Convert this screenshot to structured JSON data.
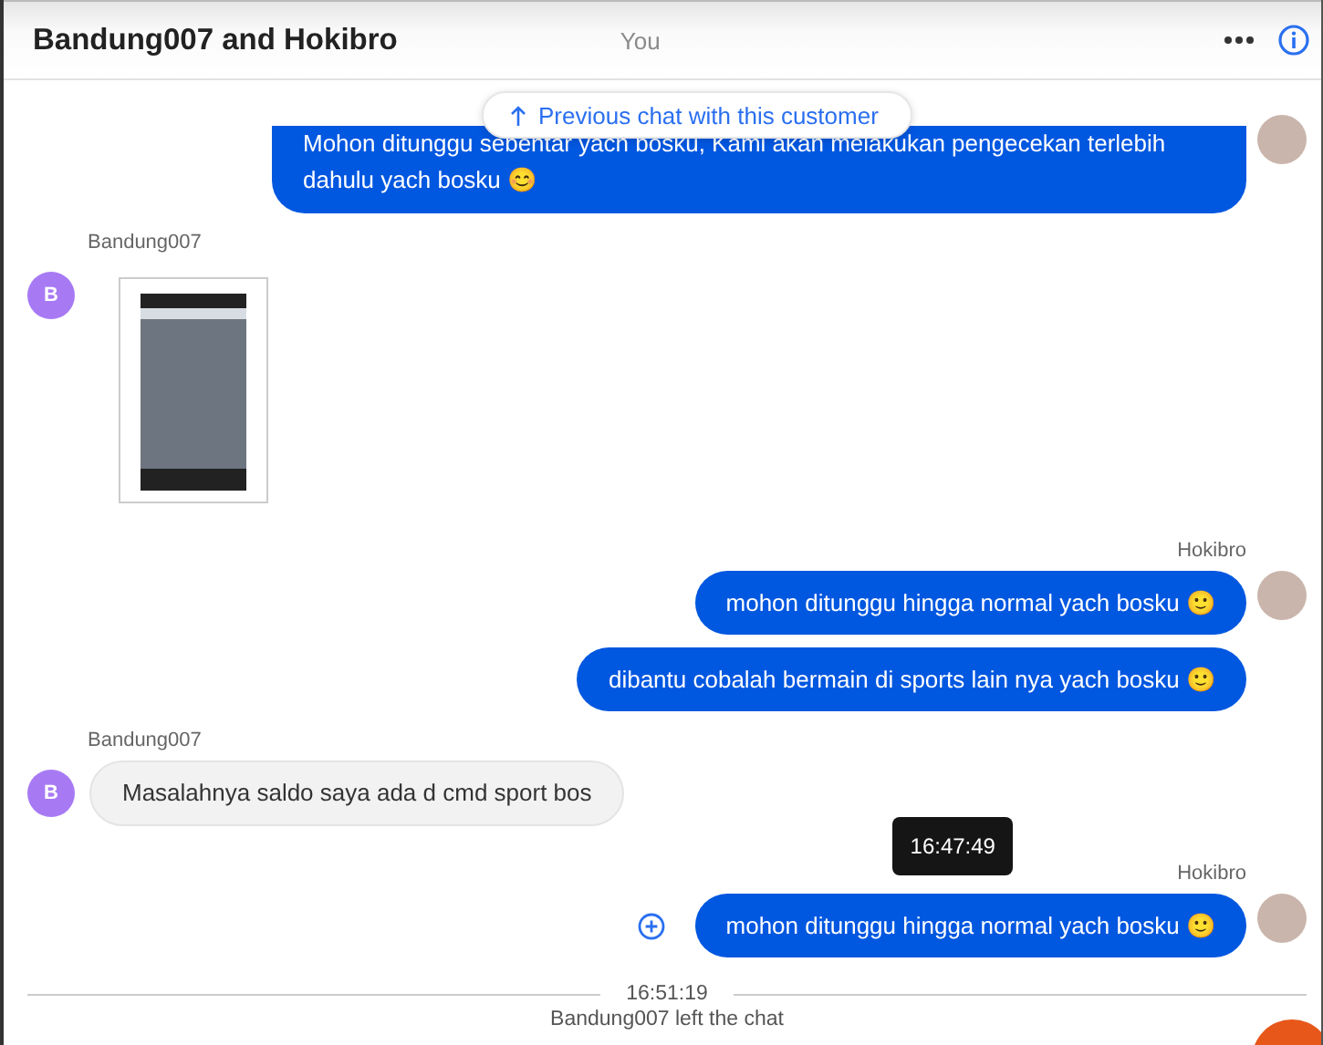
{
  "header": {
    "title": "Bandung007 and Hokibro",
    "you_label": "You"
  },
  "previous_chat_button": {
    "label": "Previous chat with this customer"
  },
  "groups": [
    {
      "kind": "agent",
      "messages": [
        {
          "kind": "text",
          "text": "Mohon ditunggu sebentar yach bosku, Kami akan melakukan pengecekan terlebih dahulu yach bosku 😊"
        }
      ]
    },
    {
      "kind": "customer",
      "sender": "Bandung007",
      "avatar_letter": "B",
      "messages": [
        {
          "kind": "image"
        }
      ]
    },
    {
      "kind": "agent",
      "sender": "Hokibro",
      "messages": [
        {
          "kind": "text",
          "text": "mohon ditunggu hingga normal yach bosku 🙂"
        },
        {
          "kind": "text",
          "text": "dibantu cobalah bermain di sports lain nya yach bosku 🙂"
        }
      ]
    },
    {
      "kind": "customer",
      "sender": "Bandung007",
      "avatar_letter": "B",
      "messages": [
        {
          "kind": "text",
          "text": "Masalahnya saldo saya ada d cmd sport bos"
        }
      ]
    },
    {
      "kind": "agent",
      "sender": "Hokibro",
      "messages": [
        {
          "kind": "text",
          "text": "mohon ditunggu hingga normal yach bosku 🙂",
          "tooltip": "16:47:49"
        }
      ]
    }
  ],
  "system_event": {
    "time": "16:51:19",
    "text": "Bandung007 left the chat"
  }
}
